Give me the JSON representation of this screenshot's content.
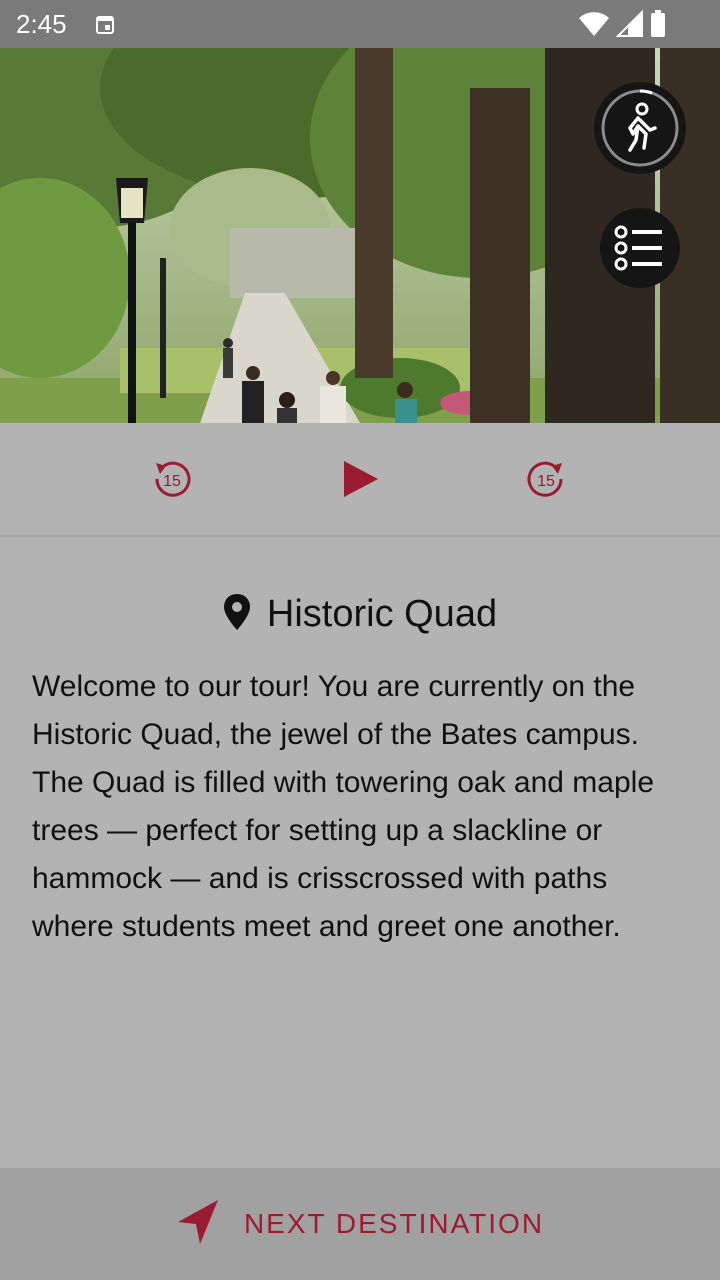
{
  "status_bar": {
    "time": "2:45",
    "icons": [
      "calendar-icon",
      "wifi-icon",
      "cellular-signal-icon",
      "battery-icon"
    ]
  },
  "hero": {
    "fabs": [
      {
        "icon": "walking-person-icon"
      },
      {
        "icon": "list-icon"
      }
    ]
  },
  "player": {
    "rewind_label": "15",
    "forward_label": "15",
    "controls": [
      "replay-15-icon",
      "play-icon",
      "forward-15-icon"
    ]
  },
  "location": {
    "icon": "location-pin-icon",
    "title": "Historic Quad",
    "description": "Welcome to our tour! You are currently on the Historic Quad, the jewel of the Bates campus. The Quad is filled with towering oak and maple trees — perfect for setting up a slackline or hammock — and is crisscrossed with paths where students meet and greet one another."
  },
  "footer": {
    "next_label": "NEXT DESTINATION",
    "icon": "navigation-arrow-icon"
  },
  "colors": {
    "accent": "#9b1b30",
    "status_bar": "#7a7a7a",
    "background": "#b3b3b3",
    "footer": "#a1a1a1"
  }
}
